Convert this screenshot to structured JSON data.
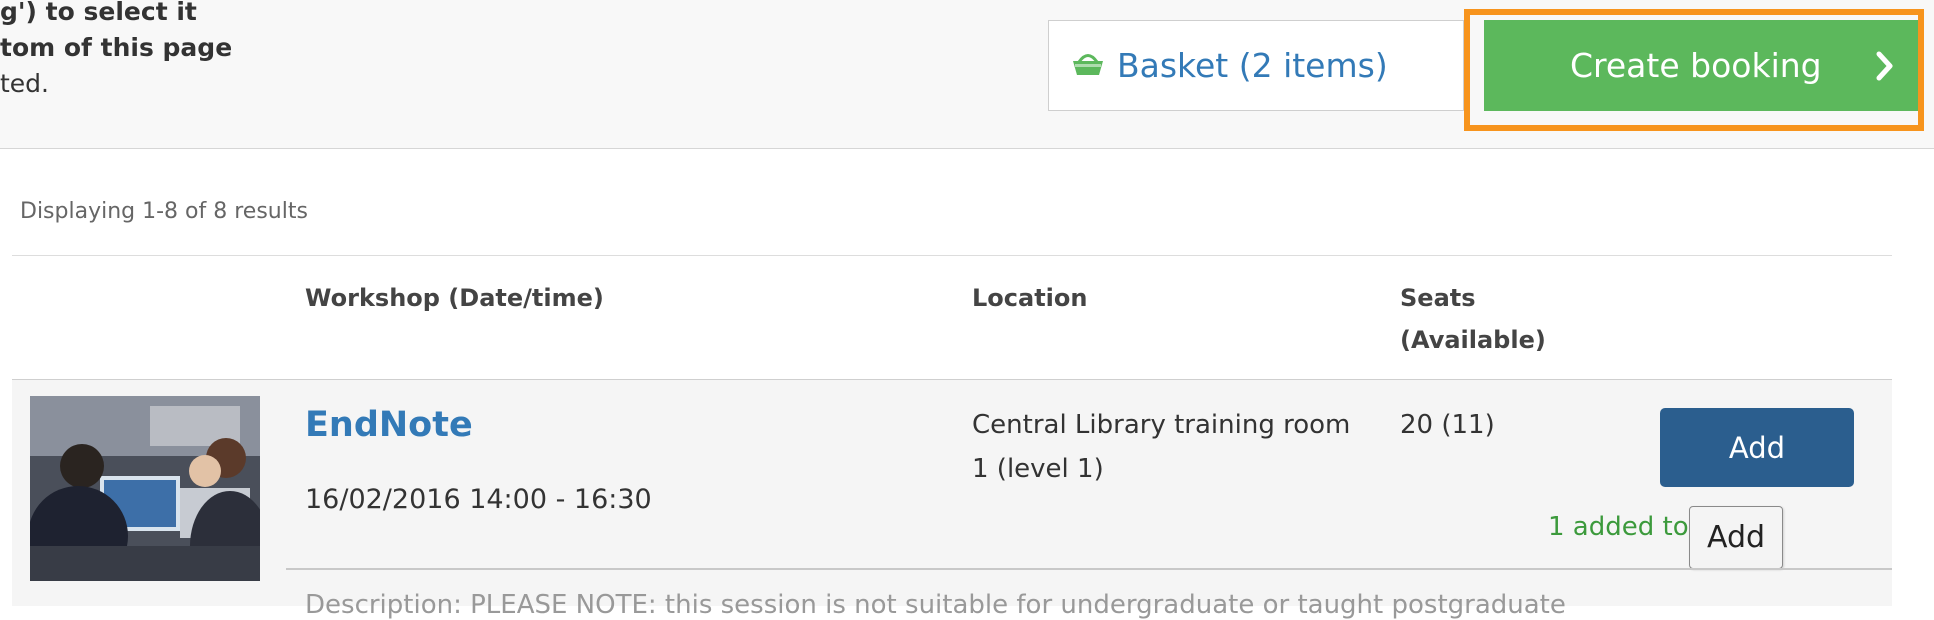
{
  "instructions": {
    "line1": "g') to select it",
    "line2": "tom of this page",
    "line3": "ted."
  },
  "header_actions": {
    "basket_label": "Basket (2 items)",
    "create_booking_label": "Create booking",
    "accent_color": "#5cb85c",
    "highlight_color": "#f7941d"
  },
  "results": {
    "count_text": "Displaying 1-8 of 8 results"
  },
  "table": {
    "headers": {
      "workshop": "Workshop (Date/time)",
      "location": "Location",
      "seats_line1": "Seats",
      "seats_line2": "(Available)"
    },
    "rows": [
      {
        "title": "EndNote",
        "datetime": "16/02/2016 14:00 - 16:30",
        "location": "Central Library training room 1 (level 1)",
        "seats": "20 (11)",
        "add_label": "Add",
        "basket_note": "1 added to basket",
        "description": "Description: PLEASE NOTE: this session is not suitable for undergraduate or taught postgraduate"
      }
    ]
  },
  "tooltip": {
    "text": "Add"
  }
}
